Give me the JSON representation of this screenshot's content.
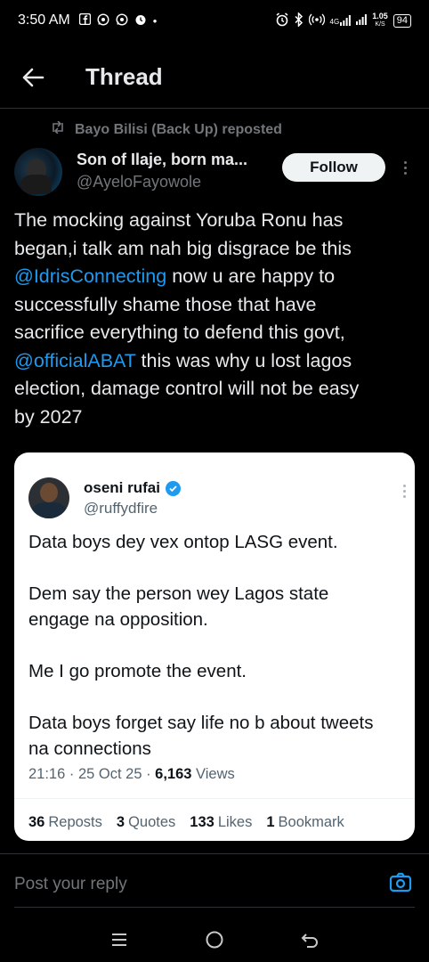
{
  "status_bar": {
    "time": "3:50 AM",
    "notification_icons": [
      "facebook-icon",
      "whatsapp-icon",
      "whatsapp-icon",
      "alarm-icon"
    ],
    "dot": "•",
    "network": "4G",
    "speed_value": "1.05",
    "speed_unit": "K/S",
    "battery": "94"
  },
  "header": {
    "title": "Thread",
    "back_icon": "back-arrow-icon"
  },
  "repost": {
    "icon": "repost-icon",
    "text": "Bayo Bilisi (Back Up) reposted"
  },
  "post": {
    "author_name": "Son of Ilaje, born ma...",
    "author_handle": "@AyeloFayowole",
    "follow_label": "Follow",
    "lines": [
      {
        "text": "The mocking against  Yoruba Ronu has"
      },
      {
        "text": "began,i talk am nah big disgrace be this"
      },
      {
        "mention": "@IdrisConnecting",
        "text": " now u are happy to"
      },
      {
        "text": "successfully shame those that have"
      },
      {
        "text": "sacrifice everything to defend this govt,"
      },
      {
        "mention": "@officialABAT",
        "text": " this was why u lost lagos"
      },
      {
        "text": "election, damage control will not be easy"
      },
      {
        "text": "by 2027"
      }
    ]
  },
  "quote": {
    "author_name": "oseni rufai",
    "author_handle": "@ruffydfire",
    "paragraphs": [
      [
        "Data boys dey vex ontop  LASG event."
      ],
      [
        "Dem say the person wey Lagos state",
        "engage na opposition."
      ],
      [
        "Me I go promote the event."
      ],
      [
        "Data boys forget say life no b about tweets",
        "na connections"
      ]
    ],
    "timestamp": "21:16 · 25 Oct 25 · ",
    "views_count": "6,163",
    "views_label": " Views",
    "stats": [
      {
        "count": "36",
        "label": "Reposts"
      },
      {
        "count": "3",
        "label": "Quotes"
      },
      {
        "count": "133",
        "label": "Likes"
      },
      {
        "count": "1",
        "label": "Bookmark"
      }
    ]
  },
  "reply": {
    "placeholder": "Post your reply"
  },
  "colors": {
    "background": "#000000",
    "text": "#e7e9ea",
    "muted": "#71767b",
    "link": "#1d9bf0"
  }
}
